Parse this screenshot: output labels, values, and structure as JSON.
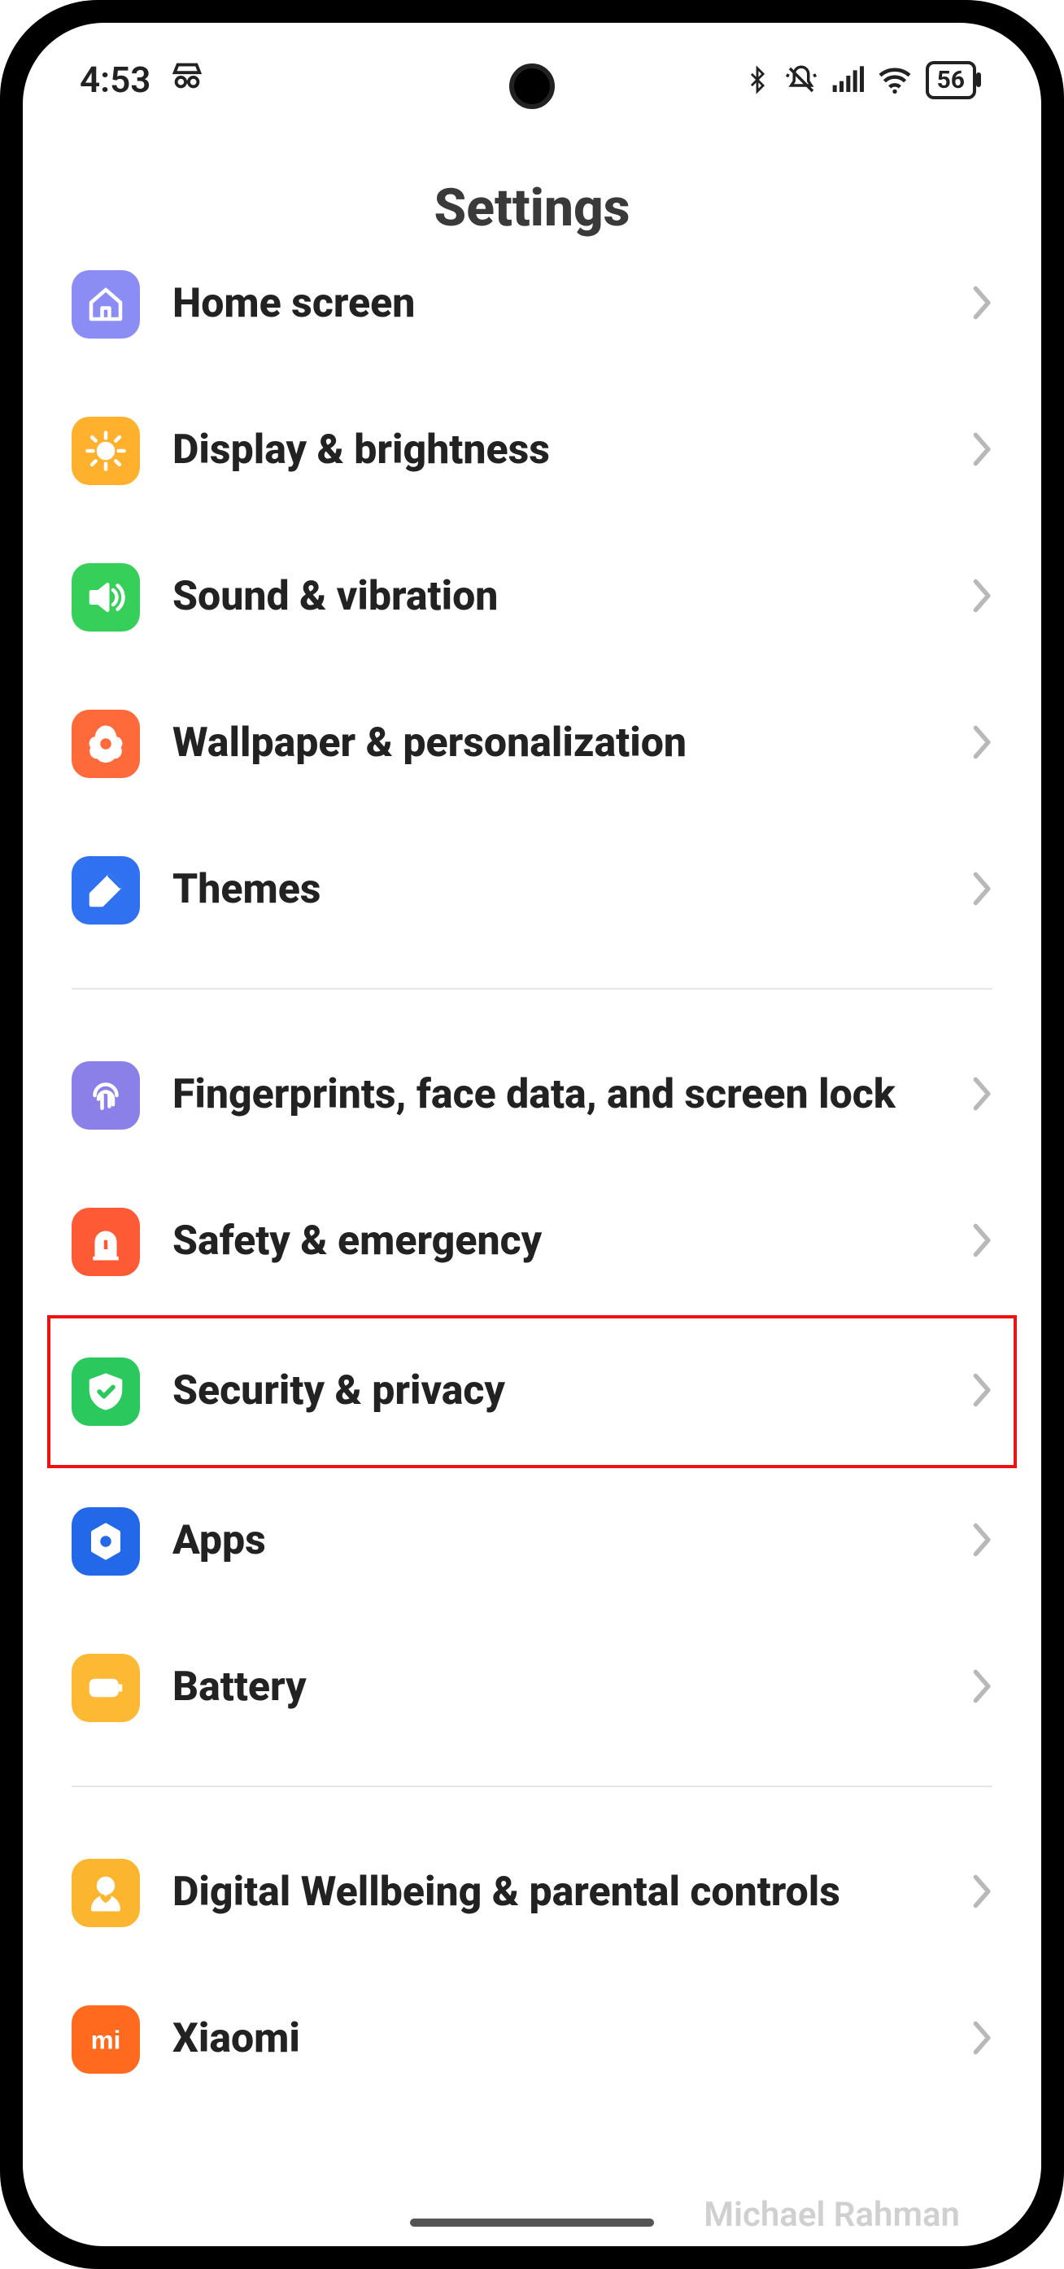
{
  "statusbar": {
    "time": "4:53",
    "battery_text": "56"
  },
  "page": {
    "title": "Settings"
  },
  "groups": [
    {
      "items": [
        {
          "id": "home-screen",
          "label": "Home screen",
          "icon": "home",
          "color": "c-purple",
          "partial_top": true
        },
        {
          "id": "display",
          "label": "Display & brightness",
          "icon": "sun",
          "color": "c-orange"
        },
        {
          "id": "sound",
          "label": "Sound & vibration",
          "icon": "speaker",
          "color": "c-green"
        },
        {
          "id": "wallpaper",
          "label": "Wallpaper & personaliza­tion",
          "icon": "flower",
          "color": "c-orange2"
        },
        {
          "id": "themes",
          "label": "Themes",
          "icon": "brush",
          "color": "c-blue"
        }
      ]
    },
    {
      "items": [
        {
          "id": "biometrics",
          "label": "Fingerprints, face data, and screen lock",
          "icon": "fingerprint",
          "color": "c-lav"
        },
        {
          "id": "safety",
          "label": "Safety & emergency",
          "icon": "siren",
          "color": "c-red"
        },
        {
          "id": "security",
          "label": "Security & privacy",
          "icon": "shield",
          "color": "c-green2",
          "highlighted": true
        },
        {
          "id": "apps",
          "label": "Apps",
          "icon": "gear-hex",
          "color": "c-blue2"
        },
        {
          "id": "battery",
          "label": "Battery",
          "icon": "battery",
          "color": "c-yellow"
        }
      ]
    },
    {
      "items": [
        {
          "id": "wellbeing",
          "label": "Digital Wellbeing & parental controls",
          "icon": "person-heart",
          "color": "c-amber"
        },
        {
          "id": "xiaomi",
          "label": "Xiaomi",
          "icon": "mi",
          "color": "c-miorange",
          "partial_bottom": true
        }
      ]
    }
  ],
  "watermark": "Michael Rahman"
}
